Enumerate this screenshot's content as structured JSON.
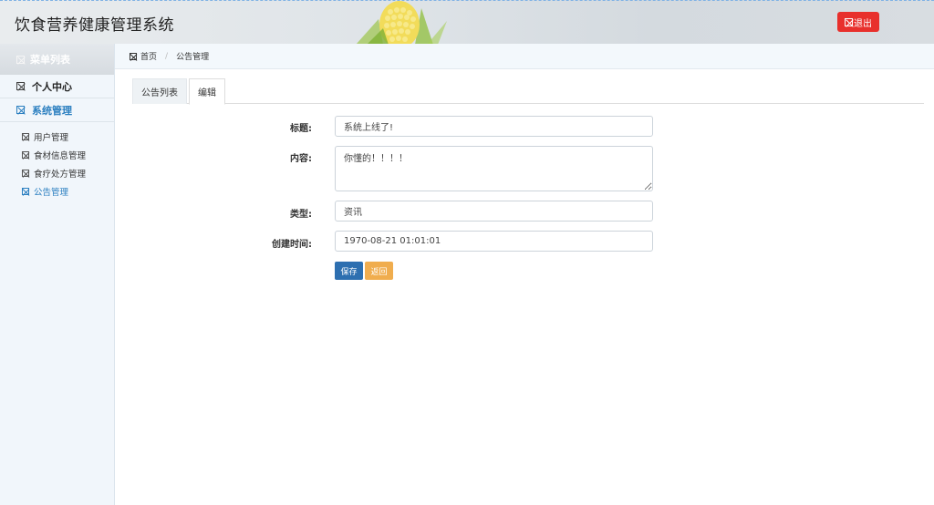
{
  "header": {
    "title": "饮食营养健康管理系统",
    "logout_label": "退出"
  },
  "sidebar": {
    "menu_title": "菜单列表",
    "groups": [
      {
        "label": "个人中心"
      },
      {
        "label": "系统管理"
      }
    ],
    "items": [
      {
        "label": "用户管理"
      },
      {
        "label": "食材信息管理"
      },
      {
        "label": "食疗处方管理"
      },
      {
        "label": "公告管理"
      }
    ]
  },
  "breadcrumb": {
    "home": "首页",
    "separator": "/",
    "current": "公告管理"
  },
  "tabs": [
    {
      "label": "公告列表"
    },
    {
      "label": "编辑"
    }
  ],
  "form": {
    "title_label": "标题:",
    "title_value": "系统上线了!",
    "content_label": "内容:",
    "content_value": "你懂的！！！！",
    "type_label": "类型:",
    "type_value": "资讯",
    "created_label": "创建时间:",
    "created_value": "1970-08-21 01:01:01",
    "save_label": "保存",
    "back_label": "返回"
  },
  "colors": {
    "accent": "#2b7fc0",
    "danger": "#e8302c",
    "primary_button": "#2d6fb0",
    "warning_button": "#f0ad4e"
  }
}
